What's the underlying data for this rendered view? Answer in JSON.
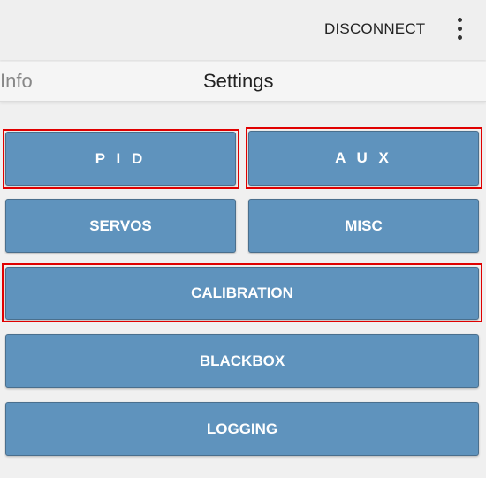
{
  "toolbar": {
    "disconnect_label": "DISCONNECT",
    "overflow_icon": "more-vert-icon"
  },
  "tabs": [
    {
      "label": "Info",
      "active": false
    },
    {
      "label": "Settings",
      "active": true
    }
  ],
  "buttons": {
    "pid": "P I D",
    "aux": "A U X",
    "servos": "SERVOS",
    "misc": "MISC",
    "calibration": "CALIBRATION",
    "blackbox": "BLACKBOX",
    "logging": "LOGGING"
  },
  "colors": {
    "button_fill": "#5f93bd",
    "highlight": "#e00000",
    "background": "#f0f0f0"
  }
}
